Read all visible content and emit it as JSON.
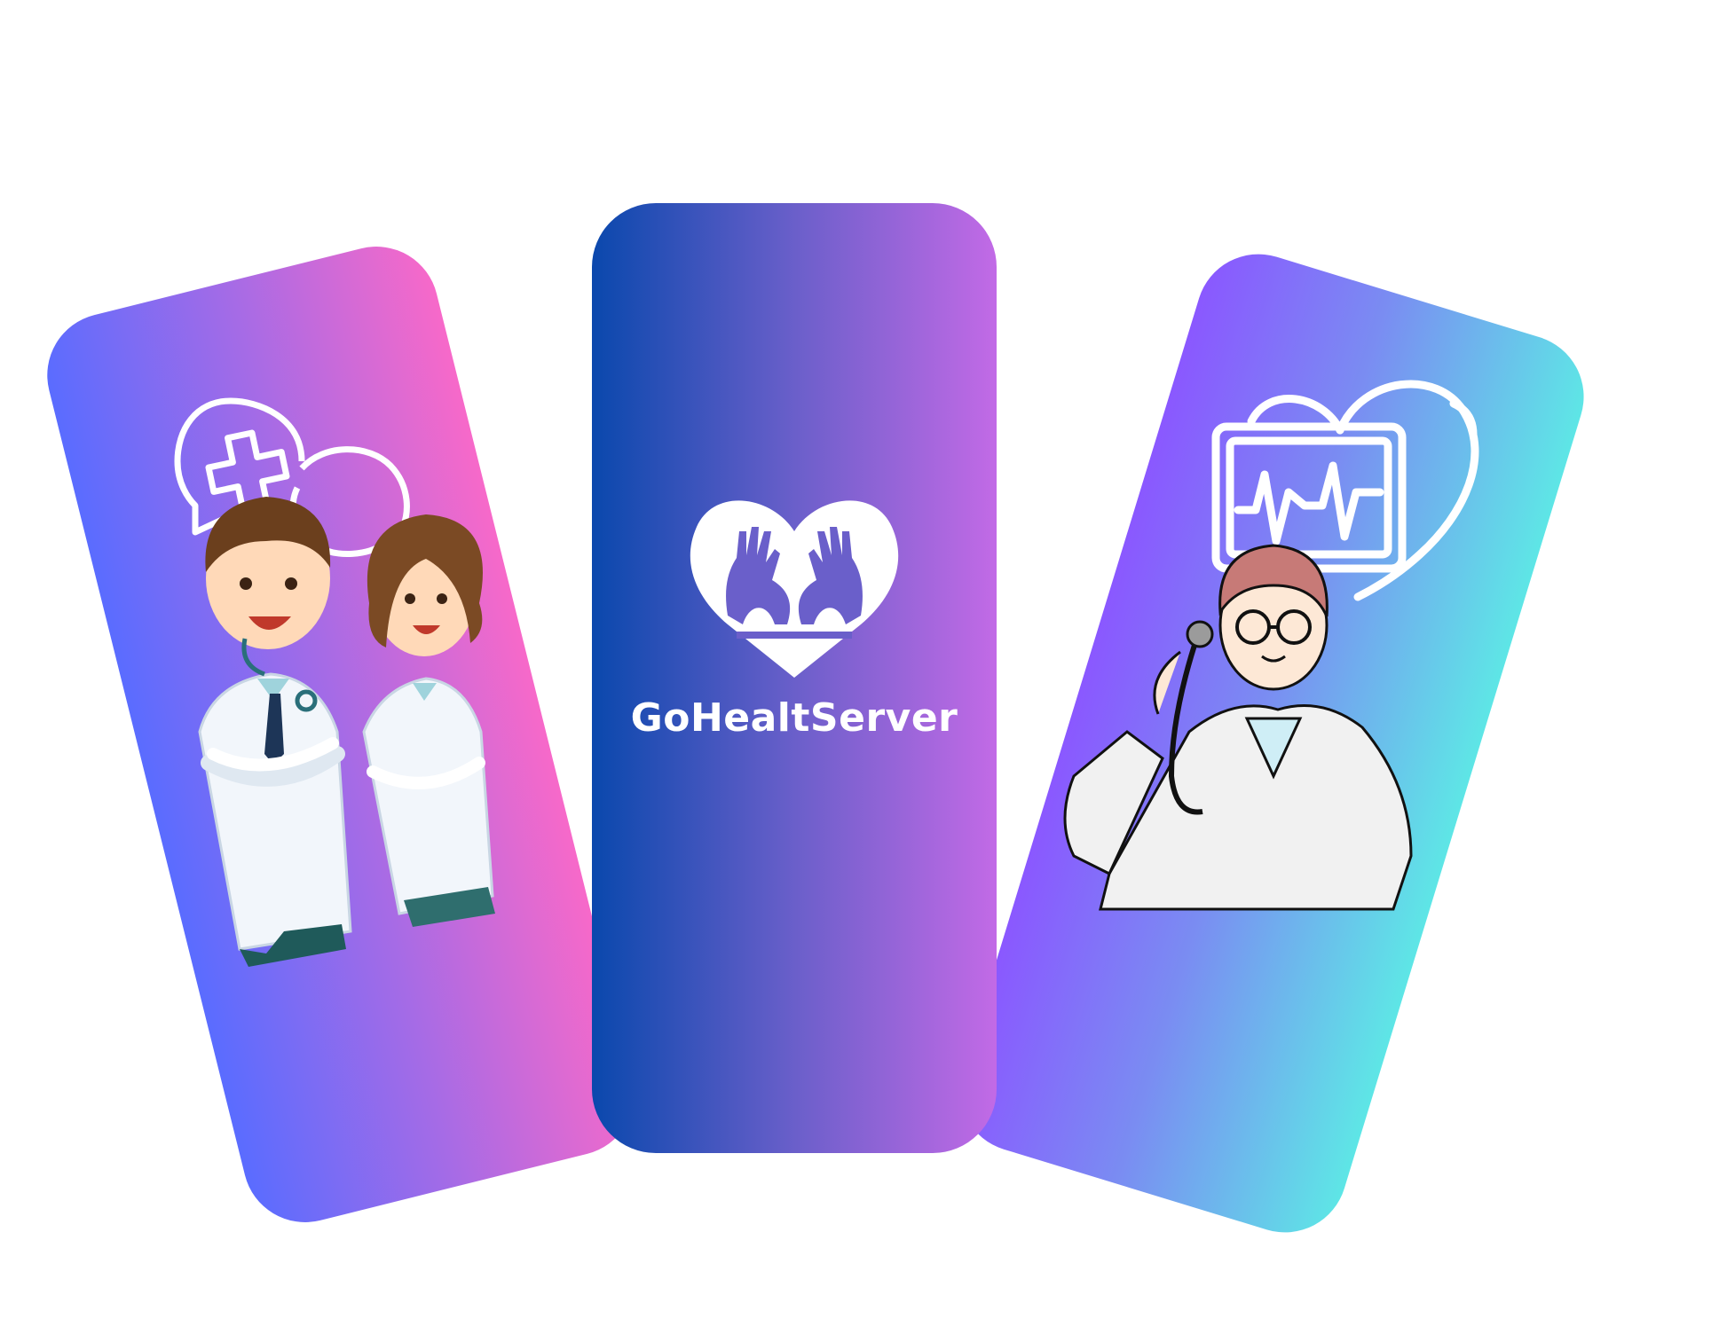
{
  "brand": {
    "name": "GoHealtServer",
    "logo_icon": "heart-hands-icon"
  },
  "cards": [
    {
      "id": "left",
      "illustration": "doctors-pair-illustration",
      "icon": "medical-chat-icon"
    },
    {
      "id": "center",
      "illustration": "brand-splash"
    },
    {
      "id": "right",
      "illustration": "doctor-stethoscope-illustration",
      "icon": "heart-monitor-icon"
    }
  ],
  "colors": {
    "left_gradient": [
      "#5a6cff",
      "#a56be6",
      "#f769c9"
    ],
    "center_gradient": [
      "#0a48ad",
      "#6a5fca",
      "#c26ae6"
    ],
    "right_gradient": [
      "#8a58ff",
      "#7a8cf2",
      "#5ee6e6"
    ],
    "text": "#ffffff"
  }
}
